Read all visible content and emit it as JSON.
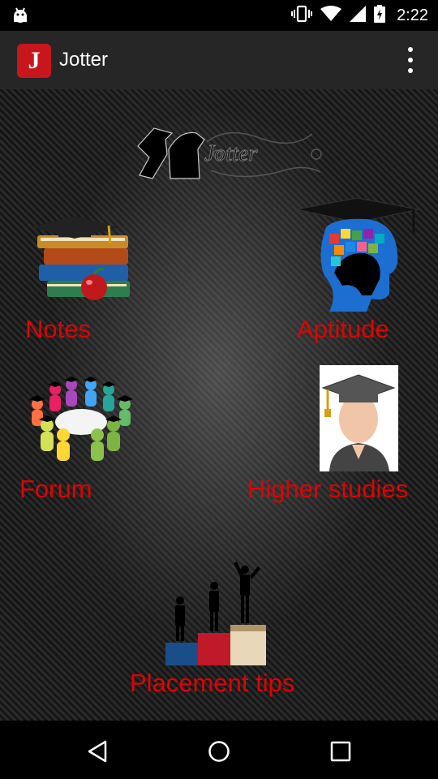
{
  "status_bar": {
    "time": "2:22"
  },
  "app_bar": {
    "logo_letter": "J",
    "title": "Jotter"
  },
  "banner": {
    "text": "Jotter"
  },
  "tiles": {
    "notes": "Notes",
    "aptitude": "Aptitude",
    "forum": "Forum",
    "higher_studies": "Higher studies",
    "placement_tips": "Placement tips"
  },
  "colors": {
    "label": "#e30000",
    "app_bar": "#262626",
    "logo": "#c8161d"
  }
}
